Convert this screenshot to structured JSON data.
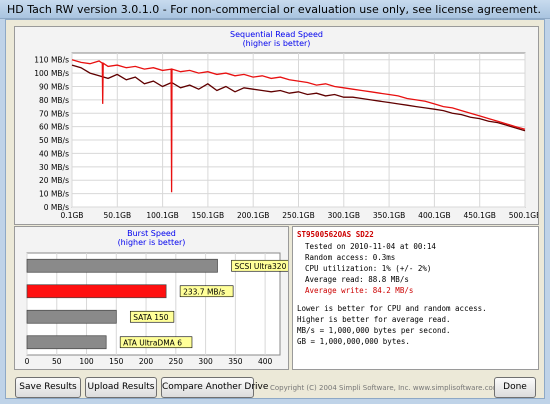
{
  "window": {
    "title": "HD Tach RW version 3.0.1.0  - For non-commercial or evaluation use only, see license agreement."
  },
  "chart_data": [
    {
      "type": "line",
      "title": "Sequential Read Speed",
      "subtitle": "(higher is better)",
      "xlabel": "",
      "ylabel": "",
      "x_ticks": [
        "0.1GB",
        "50.1GB",
        "100.1GB",
        "150.1GB",
        "200.1GB",
        "250.1GB",
        "300.1GB",
        "350.1GB",
        "400.1GB",
        "450.1GB",
        "500.1GB"
      ],
      "y_ticks": [
        "0 MB/s",
        "10 MB/s",
        "20 MB/s",
        "30 MB/s",
        "40 MB/s",
        "50 MB/s",
        "60 MB/s",
        "70 MB/s",
        "80 MB/s",
        "90 MB/s",
        "100 MB/s",
        "110 MB/s"
      ],
      "xlim": [
        0.1,
        500.1
      ],
      "ylim": [
        0,
        115
      ],
      "grid": true,
      "colors": {
        "read": "#e81010",
        "write": "#600000"
      },
      "series": [
        {
          "key": "read",
          "x": [
            0.1,
            10,
            20,
            30,
            40,
            50,
            60,
            70,
            80,
            90,
            100,
            110,
            120,
            130,
            140,
            150,
            160,
            170,
            180,
            190,
            200,
            210,
            220,
            230,
            240,
            250,
            260,
            270,
            280,
            290,
            300,
            310,
            320,
            330,
            340,
            350,
            360,
            370,
            380,
            390,
            400,
            410,
            420,
            430,
            440,
            450,
            460,
            470,
            480,
            490,
            500.1
          ],
          "values": [
            110,
            108,
            107,
            109,
            105,
            106,
            104,
            105,
            103,
            104,
            102,
            103,
            101,
            102,
            100,
            101,
            99,
            100,
            98,
            99,
            97,
            98,
            96,
            97,
            95,
            94,
            93,
            91,
            92,
            90,
            89,
            88,
            87,
            86,
            85,
            84,
            83,
            81,
            80,
            79,
            77,
            75,
            74,
            72,
            70,
            68,
            66,
            64,
            62,
            60,
            58
          ]
        },
        {
          "key": "write",
          "x": [
            0.1,
            10,
            20,
            30,
            40,
            50,
            60,
            70,
            80,
            90,
            100,
            110,
            120,
            130,
            140,
            150,
            160,
            170,
            180,
            190,
            200,
            210,
            220,
            230,
            240,
            250,
            260,
            270,
            280,
            290,
            300,
            310,
            320,
            330,
            340,
            350,
            360,
            370,
            380,
            390,
            400,
            410,
            420,
            430,
            440,
            450,
            460,
            470,
            480,
            490,
            500.1
          ],
          "values": [
            106,
            104,
            100,
            98,
            96,
            99,
            95,
            97,
            92,
            94,
            90,
            93,
            89,
            91,
            88,
            92,
            87,
            90,
            86,
            89,
            88,
            87,
            86,
            87,
            85,
            86,
            84,
            85,
            83,
            84,
            82,
            82,
            81,
            80,
            79,
            78,
            77,
            76,
            75,
            74,
            73,
            72,
            70,
            69,
            67,
            66,
            64,
            63,
            61,
            59,
            57
          ]
        }
      ],
      "dips": [
        {
          "x": 34,
          "value": 77
        },
        {
          "x": 110,
          "value": 11
        }
      ]
    },
    {
      "type": "bar",
      "title": "Burst Speed",
      "subtitle": "(higher is better)",
      "xlabel": "",
      "ylabel": "",
      "x_ticks": [
        "0",
        "50",
        "100",
        "150",
        "200",
        "250",
        "300",
        "350",
        "400"
      ],
      "xlim": [
        0,
        425
      ],
      "grid": true,
      "categories": [
        "SCSI Ultra320",
        "233.7 MB/s",
        "SATA 150",
        "ATA UltraDMA 6"
      ],
      "values": [
        320,
        233.7,
        150,
        133
      ],
      "colors": [
        "#8a8a8a",
        "#ff1010",
        "#8a8a8a",
        "#8a8a8a"
      ]
    }
  ],
  "info": {
    "drive_model": "ST9500562OAS SD22",
    "tested_on": "Tested on 2010-11-04 at 00:14",
    "random_access": "Random access: 0.3ms",
    "cpu_utilization": "CPU utilization: 1% (+/- 2%)",
    "average_read": "Average read: 88.8 MB/s",
    "average_write": "Average write: 84.2 MB/s",
    "notes": [
      "Lower is better for CPU and random access.",
      "Higher is better for average read.",
      "MB/s = 1,000,000 bytes per second.",
      "GB = 1,000,000,000 bytes."
    ]
  },
  "buttons": {
    "save": "Save Results",
    "upload": "Upload Results",
    "compare": "Compare Another Drive",
    "done": "Done"
  },
  "footer": {
    "copyright": "Copyright (C) 2004 Simpli Software, Inc. www.simplisoftware.com"
  }
}
